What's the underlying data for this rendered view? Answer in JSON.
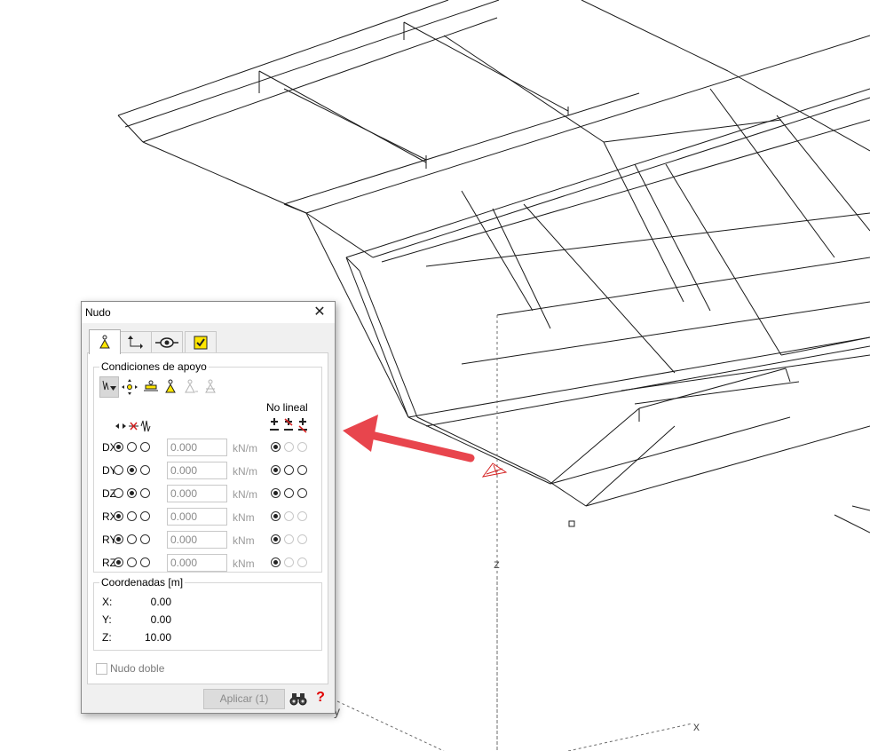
{
  "viewport": {
    "axes": {
      "z": "z",
      "x": "x",
      "y": "y"
    }
  },
  "dialog": {
    "title": "Nudo",
    "tabs": [
      {
        "icon": "node-support-icon",
        "active": true
      },
      {
        "icon": "local-axes-icon",
        "active": false
      },
      {
        "icon": "eye-icon",
        "active": false
      },
      {
        "icon": "checkbox-yellow-icon",
        "active": false
      }
    ],
    "support": {
      "legend": "Condiciones de apoyo",
      "preset_icons": [
        "spring-support-icon",
        "free-node-icon",
        "roller-support-icon",
        "pinned-support-icon",
        "pinned-support-disabled-icon",
        "fixed-support-disabled-icon"
      ],
      "header_icons": [
        "free-icon",
        "fixed-icon",
        "spring-icon"
      ],
      "nonlinear_label": "No lineal",
      "nonlinear_icons": [
        "bilateral-icon",
        "compression-only-icon",
        "tension-only-icon"
      ],
      "rows": [
        {
          "label": "DX",
          "selected": 0,
          "value": "0.000",
          "unit": "kN/m",
          "nonlinear_selected": 0,
          "nonlinear_enabled": false
        },
        {
          "label": "DY",
          "selected": 1,
          "value": "0.000",
          "unit": "kN/m",
          "nonlinear_selected": 0,
          "nonlinear_enabled": true
        },
        {
          "label": "DZ",
          "selected": 1,
          "value": "0.000",
          "unit": "kN/m",
          "nonlinear_selected": 0,
          "nonlinear_enabled": true
        },
        {
          "label": "RX",
          "selected": 0,
          "value": "0.000",
          "unit": "kNm",
          "nonlinear_selected": 0,
          "nonlinear_enabled": false
        },
        {
          "label": "RY",
          "selected": 0,
          "value": "0.000",
          "unit": "kNm",
          "nonlinear_selected": 0,
          "nonlinear_enabled": false
        },
        {
          "label": "RZ",
          "selected": 0,
          "value": "0.000",
          "unit": "kNm",
          "nonlinear_selected": 0,
          "nonlinear_enabled": false
        }
      ]
    },
    "coordinates": {
      "legend": "Coordenadas [m]",
      "x_label": "X:",
      "x_value": "0.00",
      "y_label": "Y:",
      "y_value": "0.00",
      "z_label": "Z:",
      "z_value": "10.00"
    },
    "nudo_doble_label": "Nudo doble",
    "apply_label": "Aplicar (1)",
    "help_label": "?"
  },
  "colors": {
    "arrow": "#e8454d",
    "support_symbol": "#d42020",
    "icon_yellow": "#ffe600"
  }
}
